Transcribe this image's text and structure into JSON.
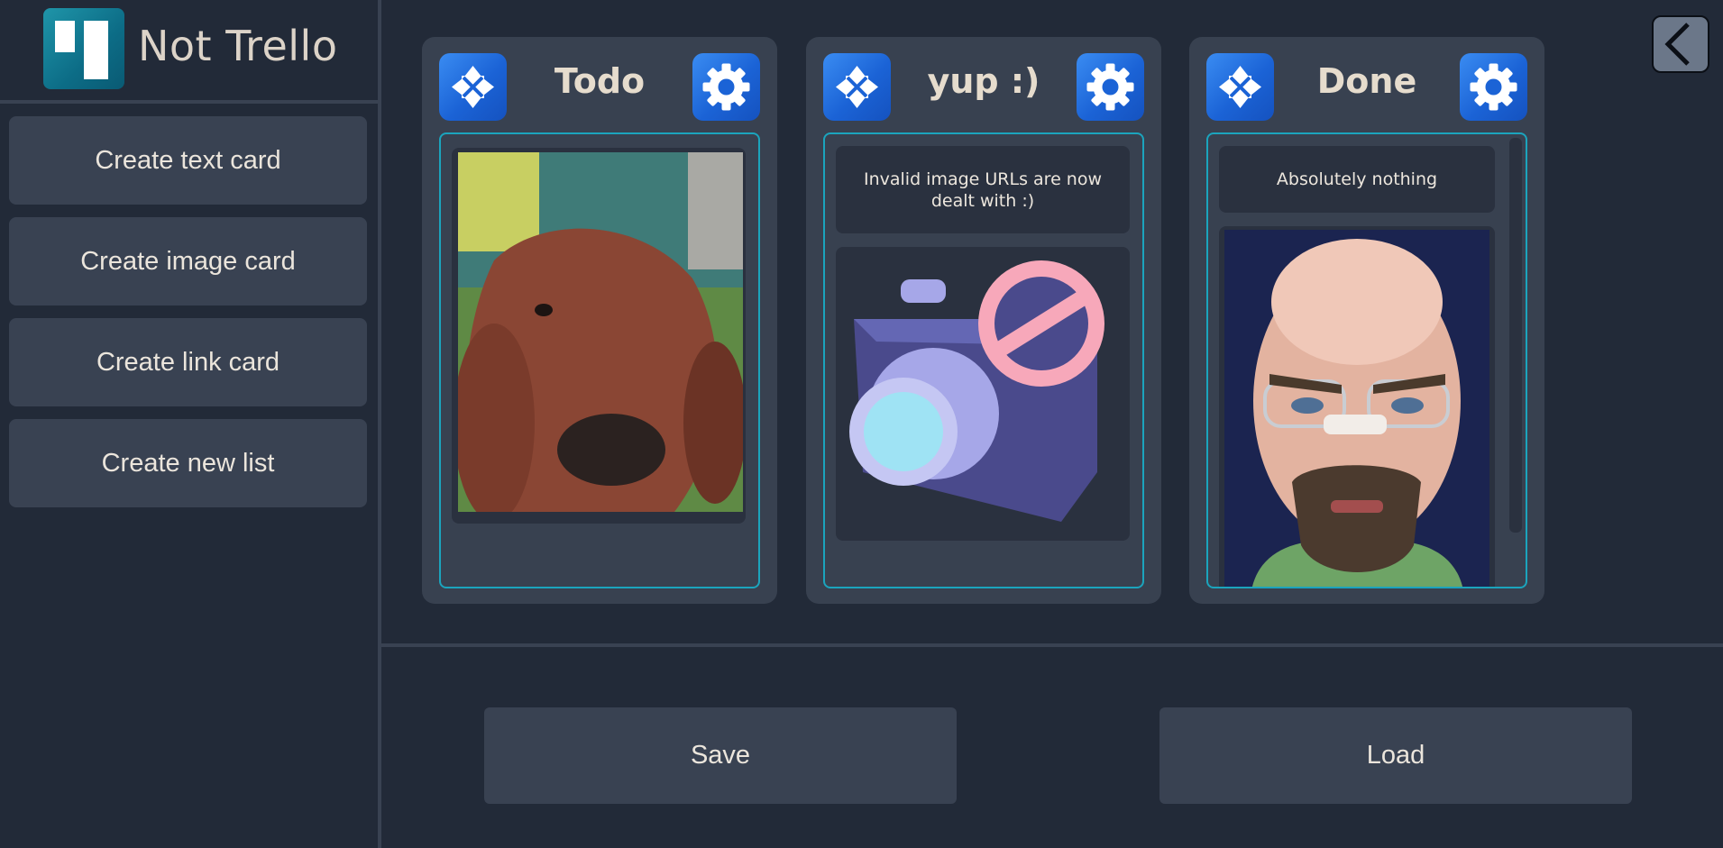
{
  "app": {
    "title": "Not Trello",
    "logo_icon": "trello-logo-icon"
  },
  "sidebar": {
    "buttons": [
      {
        "label": "Create text card"
      },
      {
        "label": "Create image card"
      },
      {
        "label": "Create link card"
      },
      {
        "label": "Create new list"
      }
    ]
  },
  "lists": [
    {
      "title": "Todo",
      "move_icon": "move-arrows-icon",
      "settings_icon": "gear-icon",
      "cards": [
        {
          "type": "image",
          "subject": "cow"
        }
      ]
    },
    {
      "title": "yup :)",
      "move_icon": "move-arrows-icon",
      "settings_icon": "gear-icon",
      "cards": [
        {
          "type": "text",
          "text": "Invalid image URLs are now dealt with :)"
        },
        {
          "type": "image",
          "subject": "no-camera-placeholder"
        }
      ]
    },
    {
      "title": "Done",
      "move_icon": "move-arrows-icon",
      "settings_icon": "gear-icon",
      "cards": [
        {
          "type": "text",
          "text": "Absolutely nothing"
        },
        {
          "type": "image",
          "subject": "bald-man-portrait"
        }
      ]
    }
  ],
  "footer": {
    "save_label": "Save",
    "load_label": "Load"
  },
  "back_icon": "chevron-left-icon",
  "colors": {
    "background": "#222a38",
    "panel": "#394252",
    "list": "#384150",
    "accent": "#1ba4bd",
    "button_blue": "#1b63d6"
  }
}
